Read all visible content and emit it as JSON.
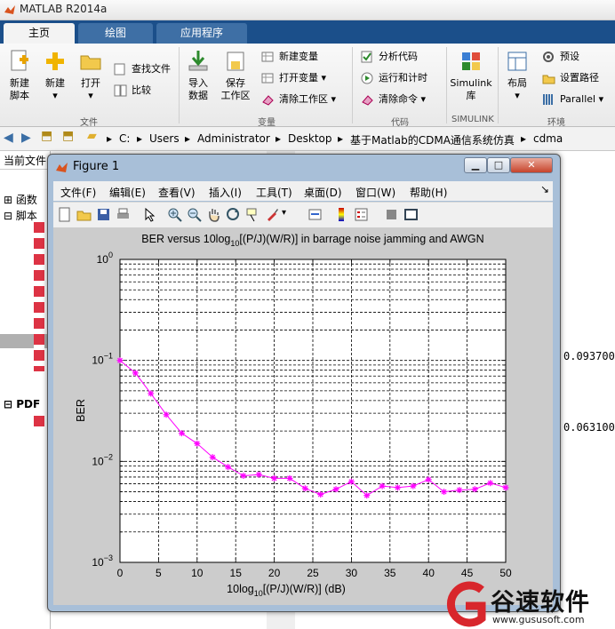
{
  "app": {
    "title": "MATLAB R2014a"
  },
  "tabs": [
    {
      "label": "主页",
      "active": true
    },
    {
      "label": "绘图",
      "active": false
    },
    {
      "label": "应用程序",
      "active": false
    }
  ],
  "ribbon": {
    "file": {
      "new_script": "新建\n脚本",
      "new": "新建",
      "open": "打开",
      "find_files": "查找文件",
      "compare": "比较",
      "group": "文件"
    },
    "variable": {
      "import": "导入\n数据",
      "save": "保存\n工作区",
      "new_var": "新建变量",
      "open_var": "打开变量",
      "clear_ws": "清除工作区",
      "group": "变量"
    },
    "code": {
      "analyze": "分析代码",
      "run_time": "运行和计时",
      "clear_cmd": "清除命令",
      "group": "代码"
    },
    "simulink": {
      "lib": "Simulink\n库",
      "group": "SIMULINK"
    },
    "env": {
      "layout": "布局",
      "prefs": "预设",
      "set_path": "设置路径",
      "parallel": "Parallel",
      "group": "环境"
    }
  },
  "path": {
    "crumbs": [
      "C:",
      "Users",
      "Administrator",
      "Desktop",
      "基于Matlab的CDMA通信系统仿真",
      "cdma"
    ]
  },
  "left_panel": {
    "header": "当前文件",
    "items": [
      "函数",
      "脚本",
      "PDF"
    ]
  },
  "right_panel": {
    "values": [
      "0.0937000",
      "0.0631000"
    ]
  },
  "figure": {
    "title": "Figure 1",
    "menus": [
      "文件(F)",
      "编辑(E)",
      "查看(V)",
      "插入(I)",
      "工具(T)",
      "桌面(D)",
      "窗口(W)",
      "帮助(H)"
    ]
  },
  "chart_data": {
    "type": "line",
    "title": "BER versus 10log10[(P/J)(W/R)] in barrage noise jamming and AWGN",
    "xlabel": "10log10[(P/J)(W/R)] (dB)",
    "ylabel": "BER",
    "xlim": [
      0,
      50
    ],
    "ylim": [
      0.001,
      1
    ],
    "yscale": "log",
    "grid": true,
    "xticks": [
      0,
      5,
      10,
      15,
      20,
      25,
      30,
      35,
      40,
      45,
      50
    ],
    "yticks": [
      0.001,
      0.01,
      0.1,
      1
    ],
    "color": "#ff00ff",
    "series": [
      {
        "x": [
          0,
          2,
          4,
          6,
          8,
          10,
          12,
          14,
          16,
          18,
          20,
          22,
          24,
          26,
          28,
          30,
          32,
          34,
          36,
          38,
          40,
          42,
          44,
          46,
          48,
          50
        ],
        "values": [
          0.1,
          0.075,
          0.047,
          0.029,
          0.019,
          0.015,
          0.011,
          0.0088,
          0.0072,
          0.0074,
          0.0068,
          0.0068,
          0.0054,
          0.0047,
          0.0053,
          0.0063,
          0.0046,
          0.0057,
          0.0055,
          0.0057,
          0.0066,
          0.005,
          0.0052,
          0.0053,
          0.0061,
          0.0055
        ]
      }
    ]
  },
  "watermark": {
    "brand": "谷速软件",
    "url": "www.gususoft.com"
  }
}
